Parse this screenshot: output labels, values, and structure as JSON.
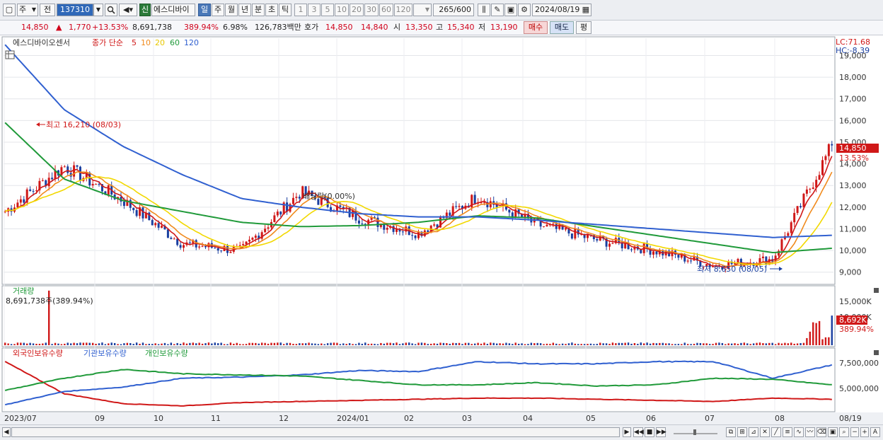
{
  "toolbar": {
    "mode_label": "주",
    "period_label": "전",
    "code": "137310",
    "search_icon": "search-icon",
    "new_label": "신",
    "stock_name": "에스디바이",
    "periods": [
      "일",
      "주",
      "월",
      "년",
      "분",
      "초",
      "틱"
    ],
    "active_period": "일",
    "minute_options": [
      "1",
      "3",
      "5",
      "10",
      "20",
      "30",
      "60",
      "120"
    ],
    "count_value": "265",
    "count_total": "/600",
    "date": "2024/08/19"
  },
  "quote": {
    "price": "14,850",
    "arrow": "▲",
    "change": "1,770",
    "change_pct": "+13.53%",
    "volume": "8,691,738",
    "volume_pct": "389.94%",
    "turnover_pct": "6.98%",
    "amount": "126,783백만",
    "hoga_label": "호가",
    "ask": "14,850",
    "bid": "14,840",
    "open_label": "시",
    "open": "13,350",
    "high_label": "고",
    "high": "15,340",
    "low_label": "저",
    "low": "13,190",
    "buy_label": "매수",
    "sell_label": "매도",
    "eval_label": "평"
  },
  "price_panel": {
    "title": "에스디바이오센서",
    "ma_label": "종가 단순",
    "ma_periods": [
      "5",
      "10",
      "20",
      "60",
      "120"
    ],
    "ma_colors": [
      "#d01818",
      "#f08a1c",
      "#f2d800",
      "#209a3a",
      "#3060d0"
    ],
    "lc": "LC:71.68",
    "hc": "HC:-8.39",
    "max_annotation": "최고 16,210 (08/03)",
    "min_annotation": "최저 8,650 (08/05)",
    "event_annotation": "배당락(0.00%)",
    "current_price_tag": "14,850",
    "current_pct_tag": "13.53%",
    "y_ticks": [
      "19,000",
      "18,000",
      "17,000",
      "16,000",
      "15,000",
      "14,000",
      "13,000",
      "12,000",
      "11,000",
      "10,000",
      "9,000"
    ]
  },
  "volume_panel": {
    "title": "거래량",
    "readout": "8,691,738주(389.94%)",
    "y_ticks": [
      "15,000K",
      "10,000K"
    ],
    "current_tag": "8,692K",
    "current_pct": "389.94%"
  },
  "holding_panel": {
    "series_labels": [
      "외국인보유수량",
      "기관보유수량",
      "개인보유수량"
    ],
    "series_colors": [
      "#d01818",
      "#3060d0",
      "#209a3a"
    ],
    "y_ticks": [
      "7,500,000",
      "5,000,000"
    ]
  },
  "x_axis": {
    "labels": [
      "2023/07",
      "09",
      "10",
      "11",
      "12",
      "2024/01",
      "02",
      "03",
      "04",
      "05",
      "06",
      "07",
      "08"
    ],
    "end_label": "08/19"
  },
  "chart_data": {
    "type": "line",
    "title": "에스디바이오센서",
    "ylim": [
      8500,
      19800
    ],
    "series": [
      {
        "name": "종가",
        "x": [
          "2023/07",
          "08",
          "09",
          "10",
          "11",
          "12",
          "2024/01",
          "02",
          "03",
          "04",
          "05",
          "06",
          "07",
          "08",
          "08/19"
        ],
        "values": [
          11800,
          13900,
          12300,
          10300,
          10000,
          12700,
          11500,
          10800,
          12500,
          11200,
          10500,
          10000,
          9300,
          9600,
          14850
        ]
      },
      {
        "name": "120",
        "values": [
          19500,
          16500,
          14800,
          13500,
          12400,
          12000,
          11700,
          11550,
          11550,
          11400,
          11200,
          11000,
          10800,
          10600,
          10700
        ]
      },
      {
        "name": "60",
        "values": [
          15900,
          13300,
          12300,
          11800,
          11300,
          11100,
          11150,
          11300,
          11600,
          11500,
          11100,
          10700,
          10300,
          9900,
          10100
        ]
      }
    ],
    "volume": {
      "max_value": 8691738,
      "ylim": [
        0,
        17000000
      ]
    },
    "holdings": {
      "ylim": [
        3500000,
        9000000
      ],
      "series": [
        {
          "name": "외국인보유수량",
          "values": [
            7900,
            5000,
            4100,
            3900,
            4200,
            4300,
            4400,
            4500,
            4600,
            4600,
            4500,
            4400,
            4300,
            4600,
            4500
          ]
        },
        {
          "name": "기관보유수량",
          "values": [
            4000,
            5200,
            5600,
            6400,
            6500,
            6700,
            7100,
            7000,
            7900,
            7700,
            7700,
            7900,
            7900,
            6400,
            7600
          ]
        },
        {
          "name": "개인보유수량",
          "values": [
            5300,
            6400,
            7200,
            6800,
            6700,
            6600,
            6200,
            5800,
            5800,
            6000,
            5700,
            5800,
            6400,
            6300,
            5800
          ]
        }
      ]
    }
  }
}
